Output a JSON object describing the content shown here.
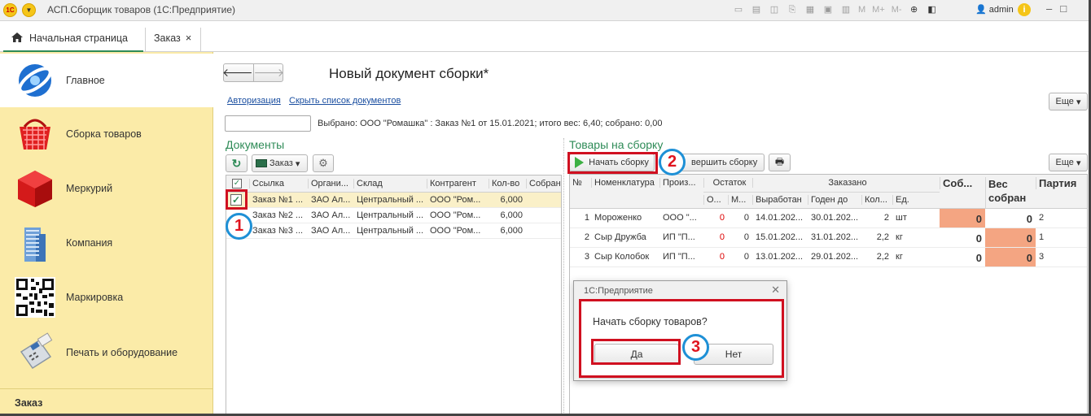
{
  "titlebar": {
    "logo": "1С",
    "title": "АСП.Сборщик товаров  (1С:Предприятие)",
    "user": "admin",
    "m_buttons": [
      "M",
      "M+",
      "M-"
    ]
  },
  "tabs": [
    {
      "label": "Начальная страница"
    },
    {
      "label": "Заказ"
    }
  ],
  "sidebar": {
    "items": [
      {
        "label": "Главное",
        "icon": "globe-icon"
      },
      {
        "label": "Сборка товаров",
        "icon": "basket-icon"
      },
      {
        "label": "Меркурий",
        "icon": "cube-icon"
      },
      {
        "label": "Компания",
        "icon": "building-icon"
      },
      {
        "label": "Маркировка",
        "icon": "qr-code-icon"
      },
      {
        "label": "Печать и оборудование",
        "icon": "card-terminal-icon"
      }
    ],
    "section": "Заказ"
  },
  "form": {
    "title": "Новый документ сборки*",
    "links": [
      "Авторизация",
      "Скрыть список документов"
    ],
    "more": "Еще",
    "selected_text": "Выбрано: ООО \"Ромашка\" : Заказ №1 от 15.01.2021; итого вес: 6,40; собрано: 0,00"
  },
  "documents": {
    "title": "Документы",
    "filter_label": "Заказ",
    "columns": [
      "Ссылка",
      "Органи...",
      "Склад",
      "Контрагент",
      "Кол-во",
      "Собран"
    ],
    "rows": [
      {
        "checked": true,
        "ref": "Заказ №1 ...",
        "org": "ЗАО Ал...",
        "warehouse": "Центральный ...",
        "contractor": "ООО \"Ром...",
        "qty": "6,000"
      },
      {
        "checked": false,
        "ref": "Заказ №2 ...",
        "org": "ЗАО Ал...",
        "warehouse": "Центральный ...",
        "contractor": "ООО \"Ром...",
        "qty": "6,000"
      },
      {
        "checked": false,
        "ref": "Заказ №3 ...",
        "org": "ЗАО Ал...",
        "warehouse": "Центральный ...",
        "contractor": "ООО \"Ром...",
        "qty": "6,000"
      }
    ]
  },
  "goods": {
    "title": "Товары на сборку",
    "start_label": "Начать сборку",
    "finish_label": "вершить сборку",
    "more": "Еще",
    "headers": {
      "no": "№",
      "nomenclature": "Номенклатура",
      "producer": "Произ...",
      "stock": "Остаток",
      "stock_o": "О...",
      "stock_m": "М...",
      "ordered": "Заказано",
      "produced": "Выработан",
      "expires": "Годен до",
      "qty": "Кол...",
      "unit": "Ед.",
      "collected": "Соб...",
      "weight1": "Вес",
      "weight2": "собран",
      "batch": "Партия"
    },
    "rows": [
      {
        "no": "1",
        "name": "Мороженко",
        "producer": "ООО \"...",
        "o": "0",
        "m": "0",
        "produced": "14.01.202...",
        "expires": "30.01.202...",
        "qty": "2",
        "unit": "шт",
        "collected": "0",
        "weight": "0",
        "batch": "2"
      },
      {
        "no": "2",
        "name": "Сыр Дружба",
        "producer": "ИП \"П...",
        "o": "0",
        "m": "0",
        "produced": "15.01.202...",
        "expires": "31.01.202...",
        "qty": "2,2",
        "unit": "кг",
        "collected": "0",
        "weight": "0",
        "batch": "1"
      },
      {
        "no": "3",
        "name": "Сыр Колобок",
        "producer": "ИП \"П...",
        "o": "0",
        "m": "0",
        "produced": "13.01.202...",
        "expires": "29.01.202...",
        "qty": "2,2",
        "unit": "кг",
        "collected": "0",
        "weight": "0",
        "batch": "3"
      }
    ]
  },
  "dialog": {
    "title": "1С:Предприятие",
    "question": "Начать сборку товаров?",
    "yes": "Да",
    "no": "Нет"
  },
  "callouts": [
    "1",
    "2",
    "3"
  ],
  "colors": {
    "accent_green": "#2e8b57",
    "sidebar_bg": "#fbeba8",
    "highlight_red": "#d01020",
    "callout_blue": "#1e90d6",
    "cell_orange": "#f4a582"
  }
}
